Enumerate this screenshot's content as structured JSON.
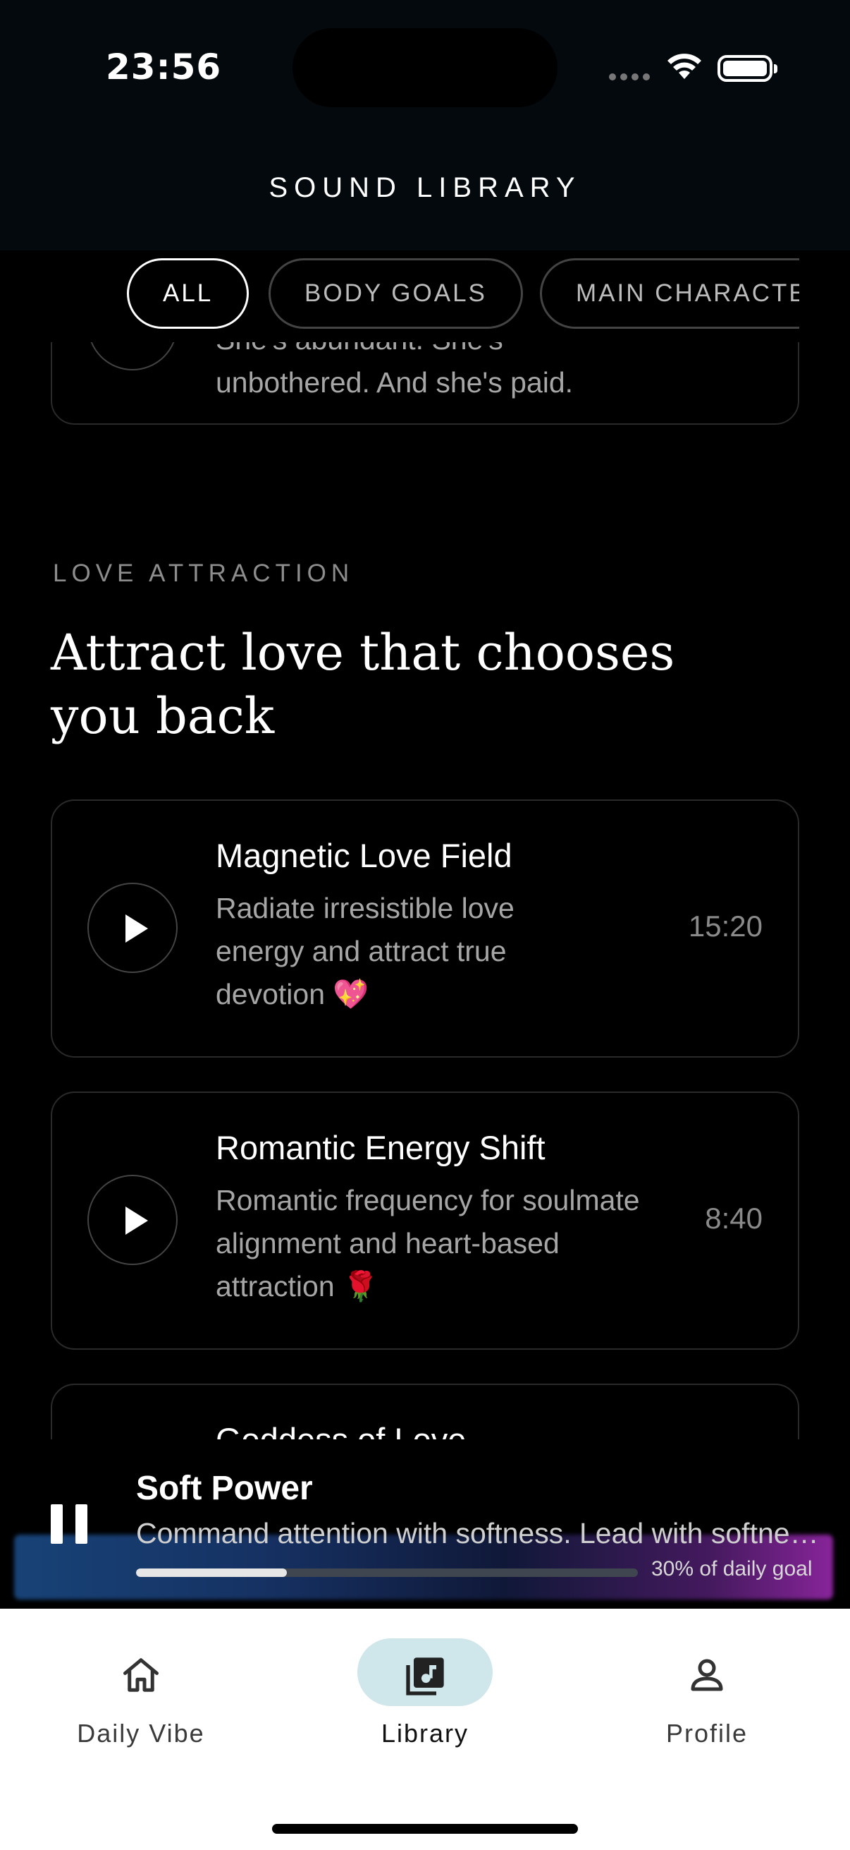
{
  "status_bar": {
    "time": "23:56"
  },
  "header": {
    "title": "SOUND LIBRARY"
  },
  "filters": [
    {
      "label": "ALL",
      "active": true
    },
    {
      "label": "BODY GOALS",
      "active": false
    },
    {
      "label": "MAIN CHARACTER",
      "active": false
    }
  ],
  "prev_card": {
    "desc_line1": "She's abundant. She's",
    "desc_line2": "unbothered. And she's paid."
  },
  "section": {
    "label": "LOVE ATTRACTION",
    "title": "Attract love that chooses you back"
  },
  "tracks": [
    {
      "title": "Magnetic Love Field",
      "desc": "Radiate irresistible love energy and attract true devotion 💖",
      "duration": "15:20"
    },
    {
      "title": "Romantic Energy Shift",
      "desc": "Romantic frequency for soulmate alignment and heart-based attraction 🌹",
      "duration": "8:40"
    },
    {
      "title": "Goddess of Love"
    }
  ],
  "player": {
    "title": "Soft Power",
    "subtitle": "Command attention with softness. Lead with softness and grace.",
    "progress": 0.3,
    "goal_text": "30% of daily goal"
  },
  "nav": [
    {
      "label": "Daily Vibe",
      "icon": "home-icon",
      "active": false
    },
    {
      "label": "Library",
      "icon": "music-library-icon",
      "active": true
    },
    {
      "label": "Profile",
      "icon": "profile-icon",
      "active": false
    }
  ],
  "colors": {
    "background": "#000000",
    "nav_pill": "#cfe6ea",
    "border": "#2a2a2a"
  }
}
